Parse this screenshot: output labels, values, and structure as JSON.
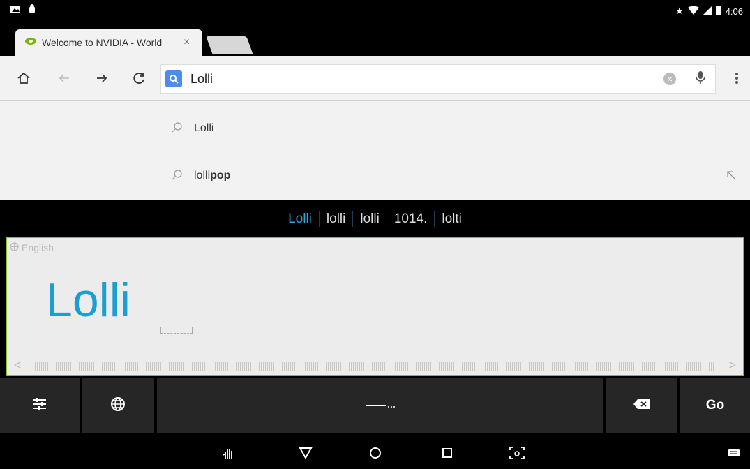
{
  "status": {
    "time": "4:06"
  },
  "tab": {
    "title": "Welcome to NVIDIA - World",
    "close": "×"
  },
  "omnibox": {
    "value": "Lolli"
  },
  "suggestions": [
    {
      "pre": "Lolli",
      "bold": ""
    },
    {
      "pre": "lolli",
      "bold": "pop"
    }
  ],
  "candidates": [
    "Lolli",
    "lolli",
    "lolli",
    "1014.",
    "lolti"
  ],
  "pad": {
    "language": "English",
    "written": "Lolli"
  },
  "keyboard": {
    "go": "Go"
  },
  "colors": {
    "accent": "#1a9fd4",
    "border": "#86bc25",
    "candidate_active": "#29a7e0"
  }
}
